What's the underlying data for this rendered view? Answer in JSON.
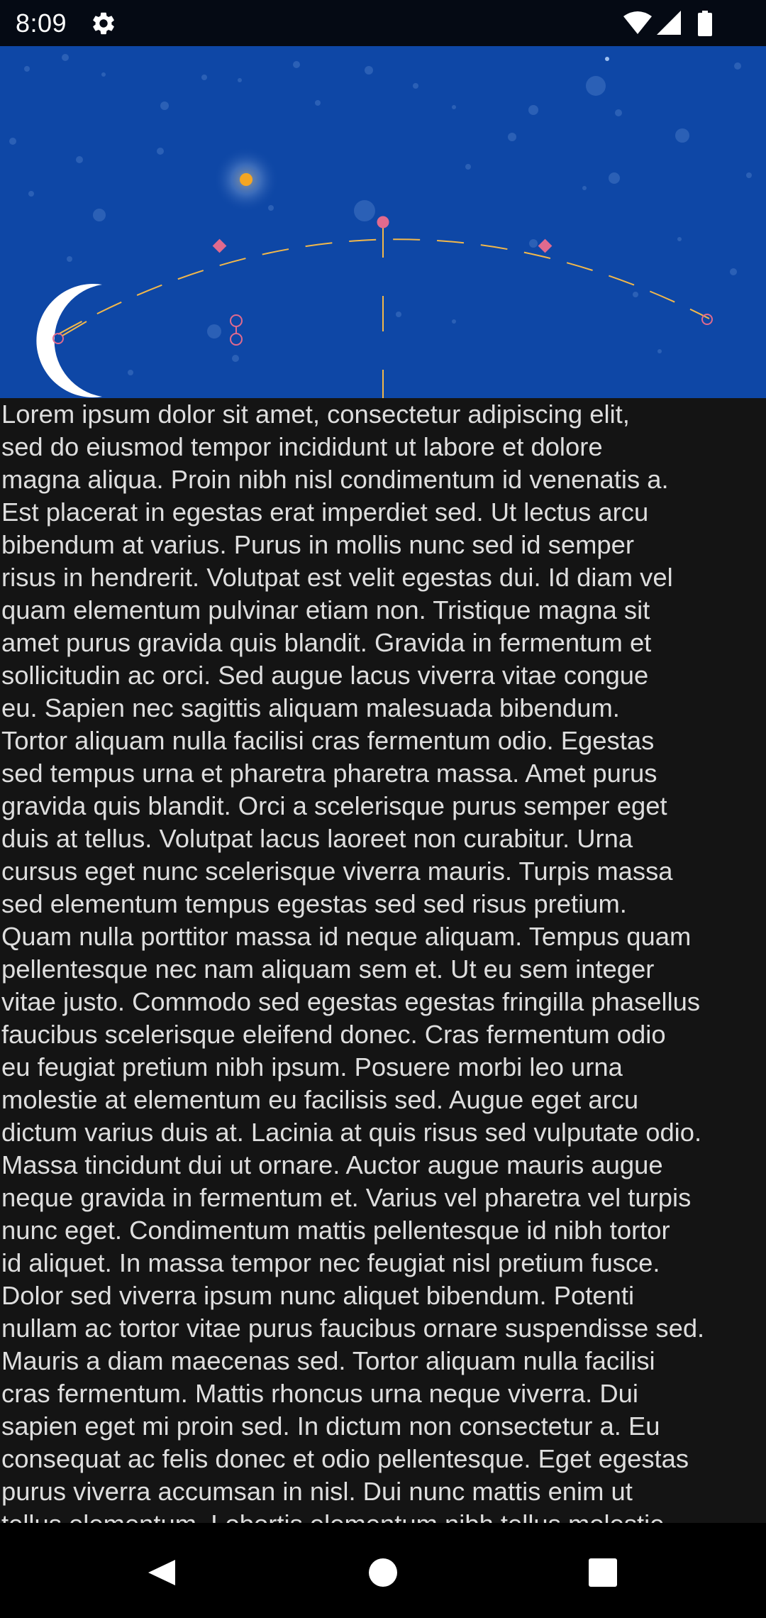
{
  "status_bar": {
    "time": "8:09",
    "icons": [
      "gear-icon",
      "wifi-icon",
      "cellular-signal-icon",
      "battery-icon"
    ]
  },
  "header_illustration": {
    "description_icons": [
      "moon-icon",
      "sun-icon",
      "sky-arc-icon",
      "stars-icon"
    ],
    "colors": {
      "sky": "#0e47a6",
      "arc": "#f2b84b",
      "marker": "#e06a8e",
      "sun": "#f5a623",
      "moon": "#ffffff"
    }
  },
  "content": {
    "text": "Lorem ipsum dolor sit amet, consectetur adipiscing elit,\nsed do eiusmod tempor incididunt ut labore et dolore\nmagna aliqua. Proin nibh nisl condimentum id venenatis a.\nEst placerat in egestas erat imperdiet sed. Ut lectus arcu\nbibendum at varius. Purus in mollis nunc sed id semper\nrisus in hendrerit. Volutpat est velit egestas dui. Id diam vel\nquam elementum pulvinar etiam non. Tristique magna sit\namet purus gravida quis blandit. Gravida in fermentum et\nsollicitudin ac orci. Sed augue lacus viverra vitae congue\neu. Sapien nec sagittis aliquam malesuada bibendum.\nTortor aliquam nulla facilisi cras fermentum odio. Egestas\nsed tempus urna et pharetra pharetra massa. Amet purus\ngravida quis blandit. Orci a scelerisque purus semper eget\nduis at tellus. Volutpat lacus laoreet non curabitur. Urna\ncursus eget nunc scelerisque viverra mauris. Turpis massa\nsed elementum tempus egestas sed sed risus pretium.\nQuam nulla porttitor massa id neque aliquam. Tempus quam\npellentesque nec nam aliquam sem et. Ut eu sem integer\nvitae justo. Commodo sed egestas egestas fringilla phasellus\nfaucibus scelerisque eleifend donec. Cras fermentum odio\neu feugiat pretium nibh ipsum. Posuere morbi leo urna\nmolestie at elementum eu facilisis sed. Augue eget arcu\ndictum varius duis at. Lacinia at quis risus sed vulputate odio.\nMassa tincidunt dui ut ornare. Auctor augue mauris augue\nneque gravida in fermentum et. Varius vel pharetra vel turpis\nnunc eget. Condimentum mattis pellentesque id nibh tortor\nid aliquet. In massa tempor nec feugiat nisl pretium fusce.\nDolor sed viverra ipsum nunc aliquet bibendum. Potenti\nnullam ac tortor vitae purus faucibus ornare suspendisse sed.\nMauris a diam maecenas sed. Tortor aliquam nulla facilisi\ncras fermentum. Mattis rhoncus urna neque viverra. Dui\nsapien eget mi proin sed. In dictum non consectetur a. Eu\nconsequat ac felis donec et odio pellentesque. Eget egestas\npurus viverra accumsan in nisl. Dui nunc mattis enim ut\ntellus elementum. Lobortis elementum nibh tellus molestie"
  },
  "nav_bar": {
    "buttons": [
      "back-icon",
      "home-icon",
      "recents-icon"
    ]
  }
}
